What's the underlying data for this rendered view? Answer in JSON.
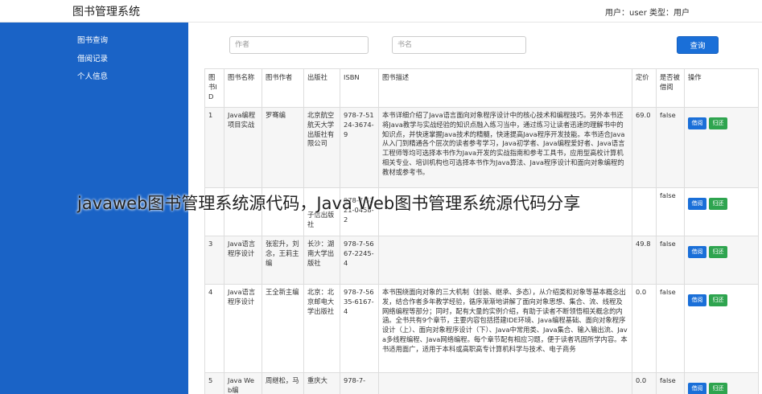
{
  "header": {
    "title": "图书管理系统",
    "user_text": "用户：user  类型：用户"
  },
  "sidebar": {
    "items": [
      {
        "label": "图书查询"
      },
      {
        "label": "借阅记录"
      },
      {
        "label": "个人信息"
      }
    ]
  },
  "search": {
    "author_placeholder": "作者",
    "name_placeholder": "书名",
    "button_label": "查询"
  },
  "table": {
    "headers": [
      "图书ID",
      "图书名称",
      "图书作者",
      "出版社",
      "ISBN",
      "图书描述",
      "定价",
      "是否被借阅",
      "操作"
    ],
    "rows": [
      {
        "id": "1",
        "name": "Java编程项目实战",
        "author": "罗骞编",
        "publisher": "北京航空航天大学出版社有限公司",
        "isbn": "978-7-5124-3674-9",
        "desc": "本书详细介绍了Java语言面向对象程序设计中的核心技术和编程技巧。另外本书还将Java教学与实战经验的知识点融入练习当中，通过练习让读者迅速的理解书中的知识点，并快速掌握Java技术的精髓，快速提高Java程序开发技能。本书适合Java从入门到精通各个层次的读者参考学习，Java初学者、Java编程爱好者、Java语言工程师等均可选择本书作为Java开发的实战指南和参考工具书，应用型高校计算机相关专业、培训机构也可选择本书作为Java算法、Java程序设计和面向对象编程的教材或参考书。",
        "price": "69.0",
        "borrowed": "false"
      },
      {
        "id": "",
        "name": "",
        "author": "",
        "publisher": "子信出版社",
        "isbn": "978-7-5221-0458-2",
        "desc": "",
        "price": "",
        "borrowed": "false"
      },
      {
        "id": "3",
        "name": "Java语言程序设计",
        "author": "张宏升，刘念，王莉主编",
        "publisher": "长沙：湖南大学出版社",
        "isbn": "978-7-5667-2245-4",
        "desc": "",
        "price": "49.8",
        "borrowed": "false"
      },
      {
        "id": "4",
        "name": "Java语言程序设计",
        "author": "王全新主编",
        "publisher": "北京：北京邮电大学出版社",
        "isbn": "978-7-5635-6167-4",
        "desc": "本书围绕面向对象的三大机制（封装、继承、多态），从介绍类和对象等基本概念出发，结合作者多年教学经验，循序渐渐地讲解了面向对象思想、集合、流、线程及网络编程等部分；同时，配有大量的实例介绍，有助于读者不断领悟相关概念的内涵。全书共有9个章节，主要内容包括搭建IDE环境、Java编程基础、面向对象程序设计（上）、面向对象程序设计（下）、Java中常用类、Java集合、输入输出流、Java多线程编程、Java网络编程。每个章节配有相应习题，便于读者巩固所学内容。本书适用面广，适用于本科或高职高专计算机科学与技术、电子商务",
        "price": "0.0",
        "borrowed": "false"
      },
      {
        "id": "5",
        "name": "Java Web编",
        "author": "周继松，马",
        "publisher": "重庆大",
        "isbn": "978-7-",
        "desc": "",
        "price": "0.0",
        "borrowed": "false"
      }
    ],
    "borrow_label": "借阅",
    "return_label": "归还"
  },
  "overlay": {
    "caption": "javaweb图书管理系统源代码，Java Web图书管理系统源代码分享"
  },
  "colors": {
    "sidebar": "#1a63c6",
    "primary": "#1a6fd8",
    "success": "#2ea44f"
  }
}
